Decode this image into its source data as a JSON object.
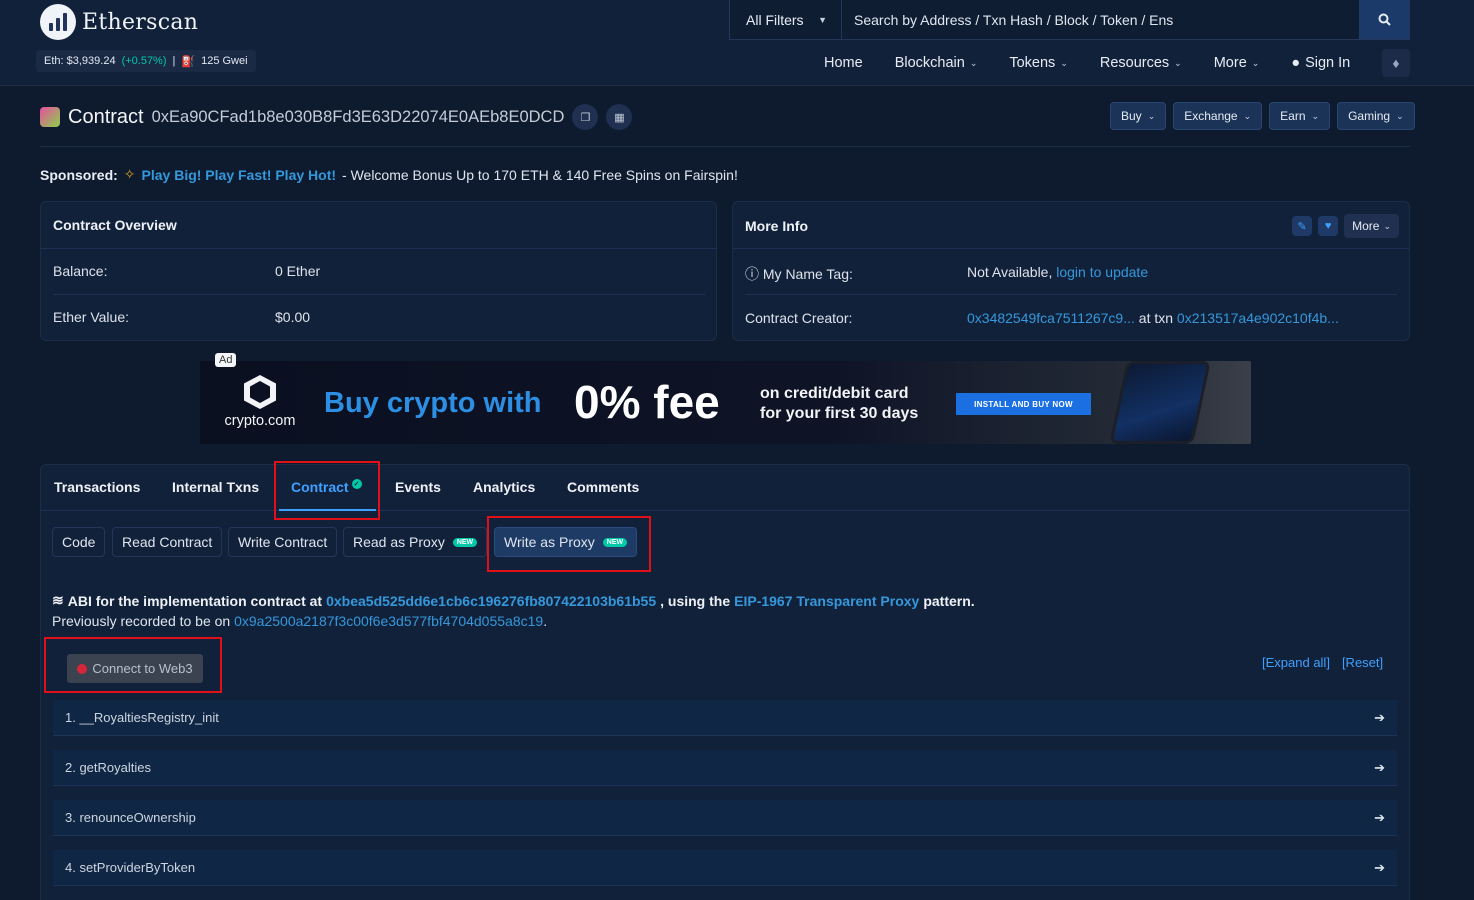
{
  "header": {
    "logo_text": "Etherscan",
    "price": {
      "label": "Eth: $3,939.24",
      "change": "(+0.57%)",
      "separator": "|",
      "gas": "125 Gwei"
    },
    "search": {
      "filter": "All Filters",
      "placeholder": "Search by Address / Txn Hash / Block / Token / Ens"
    },
    "nav": {
      "home": "Home",
      "blockchain": "Blockchain",
      "tokens": "Tokens",
      "resources": "Resources",
      "more": "More",
      "sign_in": "Sign In"
    }
  },
  "contract": {
    "label": "Contract",
    "address": "0xEa90CFad1b8e030B8Fd3E63D22074E0AEb8E0DCD",
    "actions": {
      "buy": "Buy",
      "exchange": "Exchange",
      "earn": "Earn",
      "gaming": "Gaming"
    }
  },
  "sponsored": {
    "label": "Sponsored:",
    "link": "Play Big! Play Fast! Play Hot!",
    "text": "- Welcome Bonus Up to 170 ETH & 140 Free Spins on Fairspin!"
  },
  "overview": {
    "title": "Contract Overview",
    "balance_label": "Balance:",
    "balance_value": "0 Ether",
    "ether_value_label": "Ether Value:",
    "ether_value": "$0.00"
  },
  "more_info": {
    "title": "More Info",
    "more_dropdown": "More",
    "name_tag_label": "My Name Tag:",
    "name_tag_value": "Not Available,",
    "name_tag_link": "login to update",
    "creator_label": "Contract Creator:",
    "creator_address": "0x3482549fca7511267c9...",
    "creator_at": "at txn",
    "creator_txn": "0x213517a4e902c10f4b..."
  },
  "ad": {
    "tag": "Ad",
    "brand": "crypto.com",
    "headline": "Buy crypto with",
    "big": "0% fee",
    "sub_line1": "on credit/debit card",
    "sub_line2": "for your first 30 days",
    "cta": "INSTALL AND BUY NOW"
  },
  "tabs": {
    "transactions": "Transactions",
    "internal_txns": "Internal Txns",
    "contract": "Contract",
    "events": "Events",
    "analytics": "Analytics",
    "comments": "Comments"
  },
  "subtabs": {
    "code": "Code",
    "read_contract": "Read Contract",
    "write_contract": "Write Contract",
    "read_as_proxy": "Read as Proxy",
    "write_as_proxy": "Write as Proxy",
    "new_badge": "NEW"
  },
  "abi": {
    "prefix": "ABI for the implementation contract at",
    "impl_address": "0xbea5d525dd6e1cb6c196276fb807422103b61b55",
    "mid": ", using the",
    "pattern_link": "EIP-1967 Transparent Proxy",
    "suffix": "pattern.",
    "prev_prefix": "Previously recorded to be on",
    "prev_address": "0x9a2500a2187f3c00f6e3d577fbf4704d055a8c19",
    "prev_suffix": "."
  },
  "connect": {
    "label": "Connect to Web3",
    "expand_all": "[Expand all]",
    "reset": "[Reset]"
  },
  "functions": [
    "1. __RoyaltiesRegistry_init",
    "2. getRoyalties",
    "3. renounceOwnership",
    "4. setProviderByToken"
  ],
  "colors": {
    "background": "#0e1a2e",
    "card": "#12213a",
    "link": "#3498db",
    "highlight_box": "#e01018",
    "positive": "#00c9a7"
  }
}
